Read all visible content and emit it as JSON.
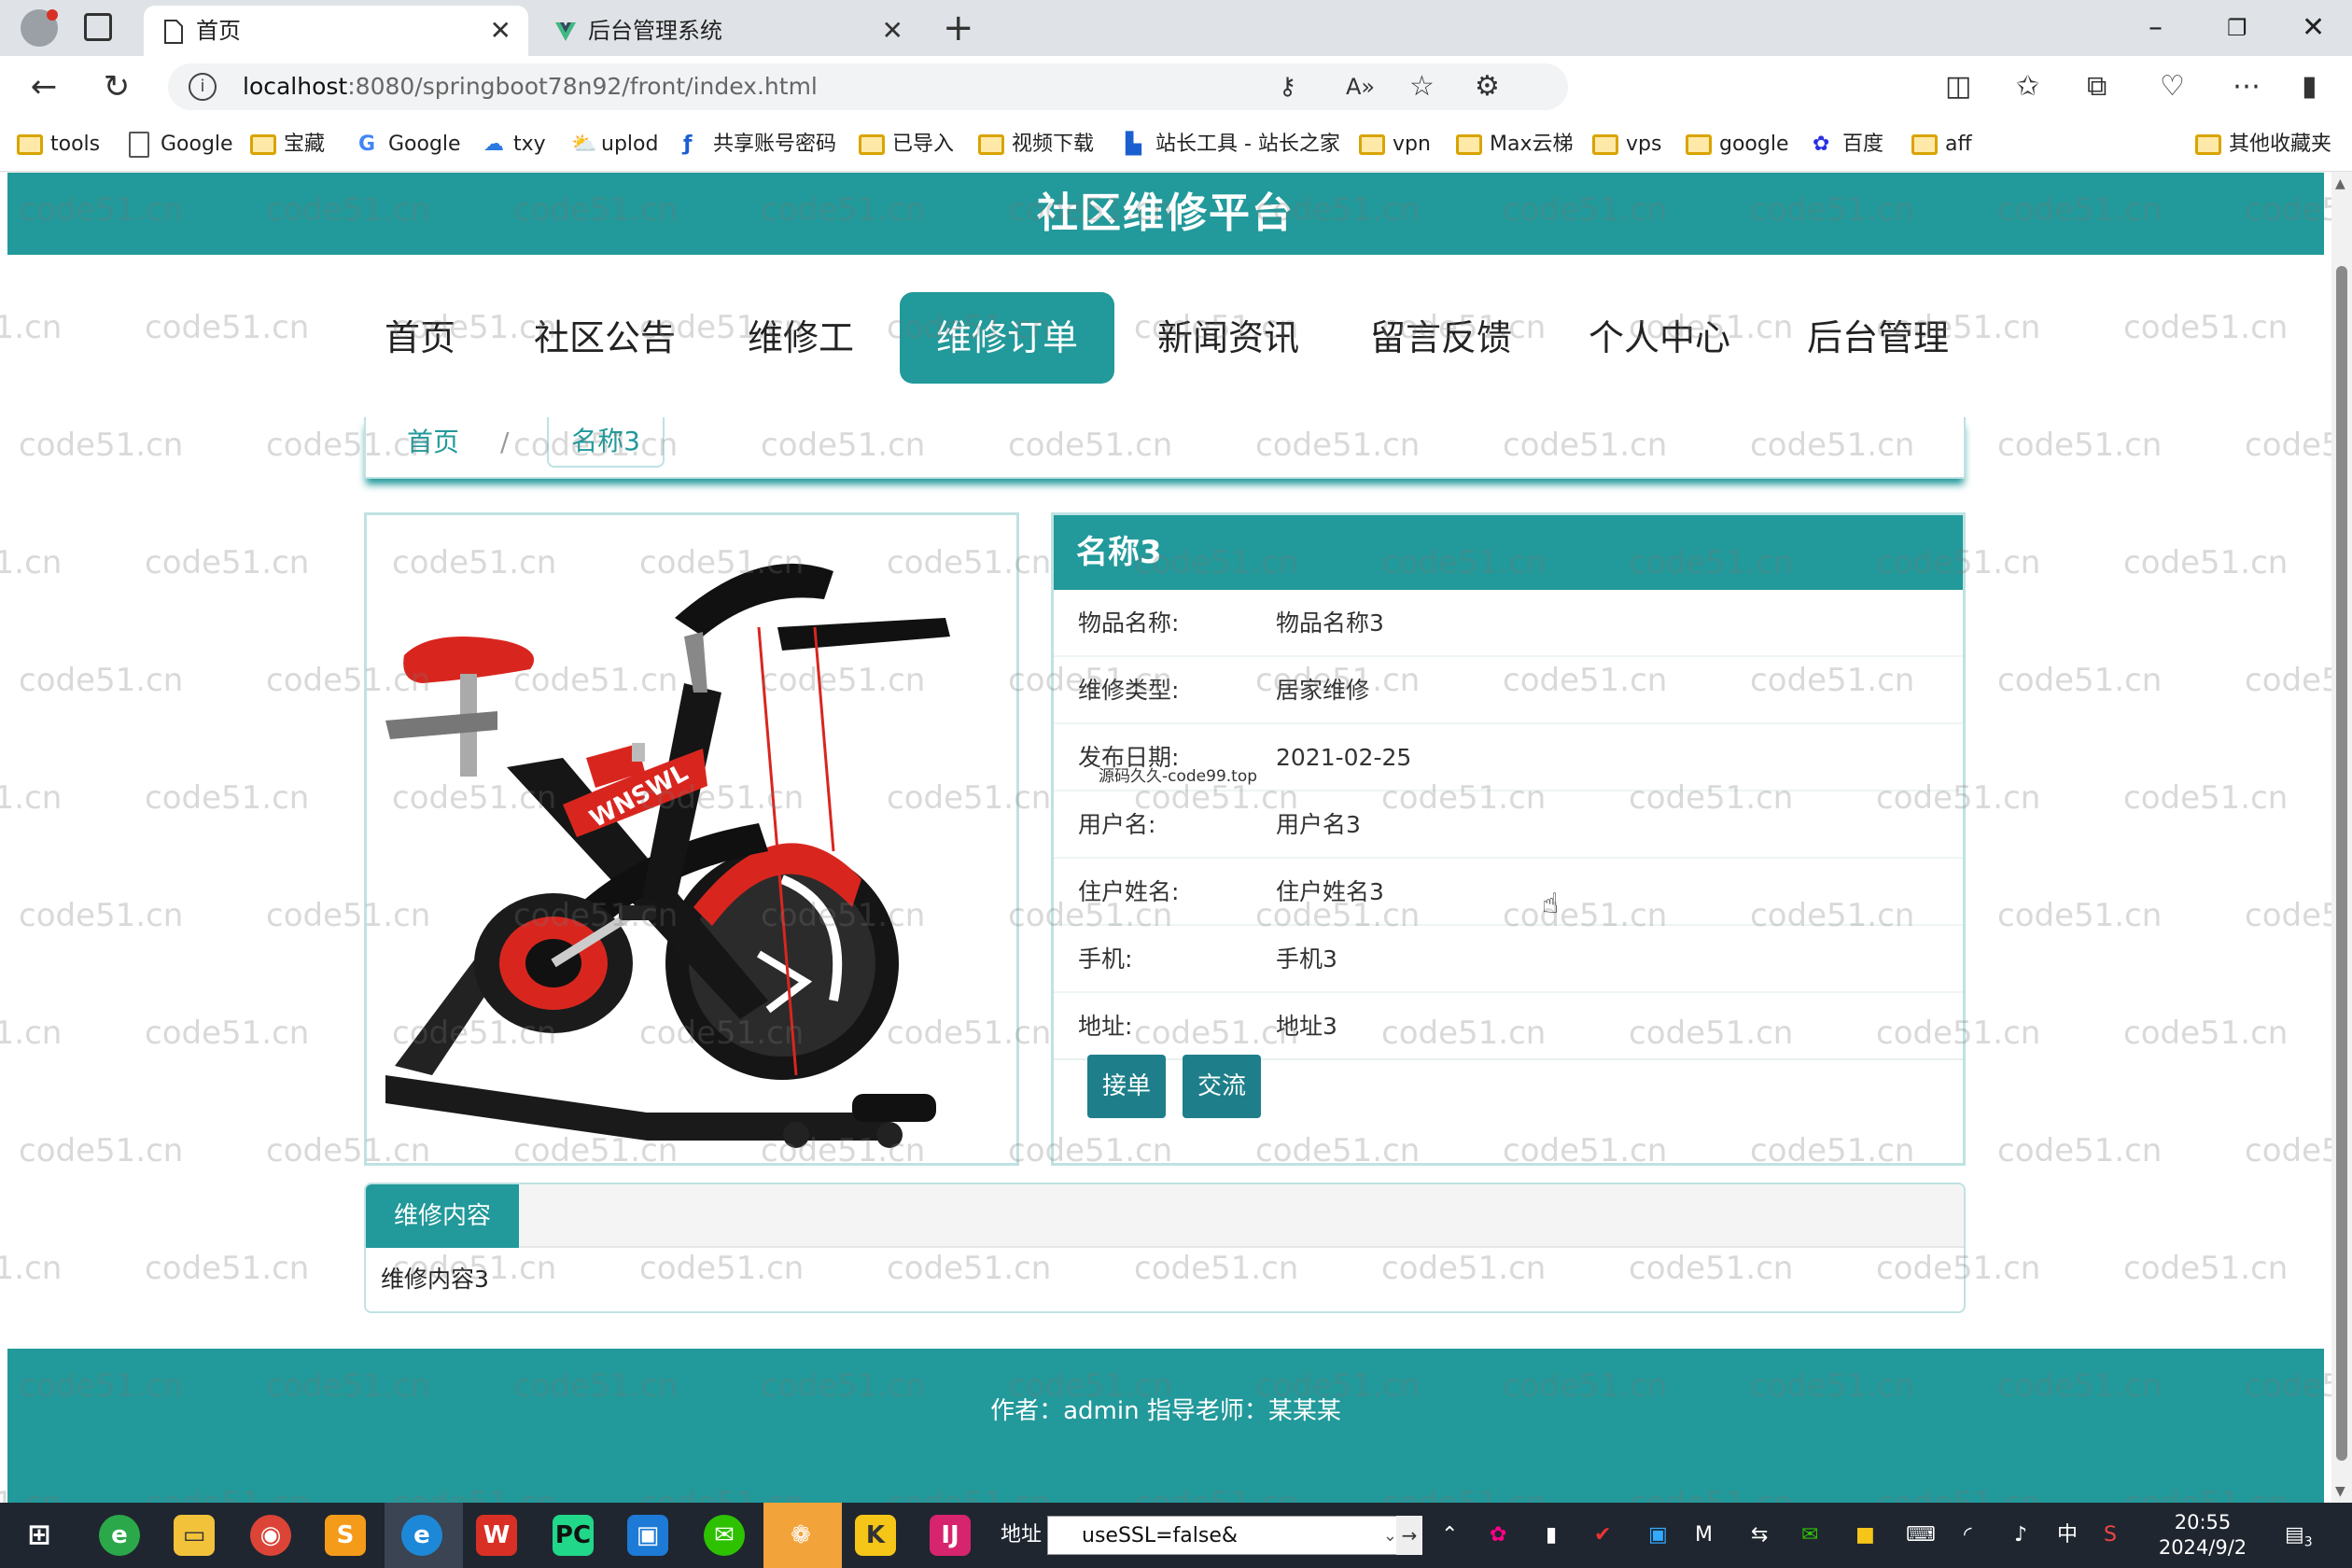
{
  "browser": {
    "tabs": [
      {
        "label": "首页",
        "icon": "page-icon",
        "active": true
      },
      {
        "label": "后台管理系统",
        "icon": "vue-icon",
        "active": false
      }
    ],
    "url_host": "localhost",
    "url_path": ":8080/springboot78n92/front/index.html",
    "bookmarks": [
      "tools",
      "Google",
      "宝藏",
      "Google",
      "txy",
      "uplod",
      "共享账号密码",
      "已导入",
      "视频下载",
      "站长工具 - 站长之家",
      "vpn",
      "Max云梯",
      "vps",
      "google",
      "百度",
      "aff"
    ],
    "other_bookmarks": "其他收藏夹"
  },
  "site": {
    "title": "社区维修平台",
    "nav": [
      "首页",
      "社区公告",
      "维修工",
      "维修订单",
      "新闻资讯",
      "留言反馈",
      "个人中心",
      "后台管理"
    ],
    "active_nav": "维修订单",
    "breadcrumb": {
      "home": "首页",
      "separator": "/",
      "current": "名称3"
    },
    "detail": {
      "title": "名称3",
      "fields": [
        {
          "label": "物品名称:",
          "value": "物品名称3"
        },
        {
          "label": "维修类型:",
          "value": "居家维修"
        },
        {
          "label": "发布日期:",
          "value": "2021-02-25"
        },
        {
          "label": "用户名:",
          "value": "用户名3"
        },
        {
          "label": "住户姓名:",
          "value": "住户姓名3"
        },
        {
          "label": "手机:",
          "value": "手机3"
        },
        {
          "label": "地址:",
          "value": "地址3"
        }
      ],
      "accept_button": "接单",
      "chat_button": "交流",
      "overlay_note": "源码久久-code99.top"
    },
    "content_tab": "维修内容",
    "content_text": "维修内容3",
    "footer": "作者：admin 指导老师：某某某",
    "watermark": "code51.cn",
    "bike_brand": "WNSWL"
  },
  "taskbar": {
    "address_label": "地址",
    "address_value": "useSSL=false&",
    "ime": "中",
    "time": "20:55",
    "date": "2024/9/2",
    "notification_count": "3"
  },
  "colors": {
    "brand": "#22999a",
    "button": "#1e7f8a",
    "bike_red": "#d8261f"
  }
}
